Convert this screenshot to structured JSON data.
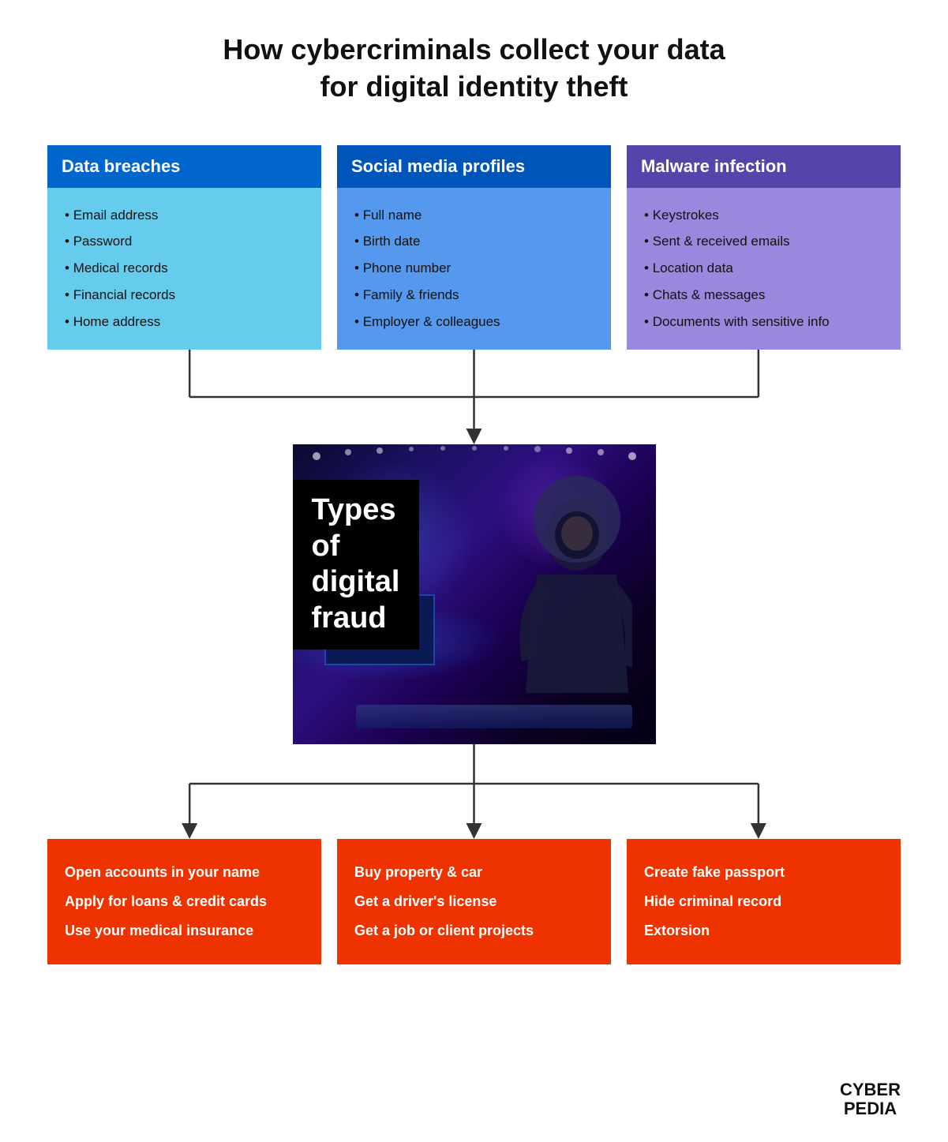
{
  "page": {
    "title_line1": "How cybercriminals collect your data",
    "title_line2": "for digital identity theft"
  },
  "top_boxes": [
    {
      "id": "data-breaches",
      "header": "Data breaches",
      "items": [
        "Email address",
        "Password",
        "Medical records",
        "Financial records",
        "Home address"
      ]
    },
    {
      "id": "social-media",
      "header": "Social media profiles",
      "items": [
        "Full name",
        "Birth date",
        "Phone number",
        "Family & friends",
        "Employer & colleagues"
      ]
    },
    {
      "id": "malware",
      "header": "Malware infection",
      "items": [
        "Keystrokes",
        "Sent & received emails",
        "Location data",
        "Chats & messages",
        "Documents with sensitive info"
      ]
    }
  ],
  "fraud_section": {
    "title": "Types of digital fraud"
  },
  "bottom_boxes": [
    {
      "id": "financial-fraud",
      "items": [
        "Open accounts in your name",
        "Apply for loans & credit cards",
        "Use your medical insurance"
      ]
    },
    {
      "id": "identity-fraud",
      "items": [
        "Buy property & car",
        "Get a driver's license",
        "Get a job or client projects"
      ]
    },
    {
      "id": "criminal-fraud",
      "items": [
        "Create fake passport",
        "Hide criminal record",
        "Extorsion"
      ]
    }
  ],
  "logo": {
    "line1": "CYBER",
    "line2": "PEDIA"
  }
}
